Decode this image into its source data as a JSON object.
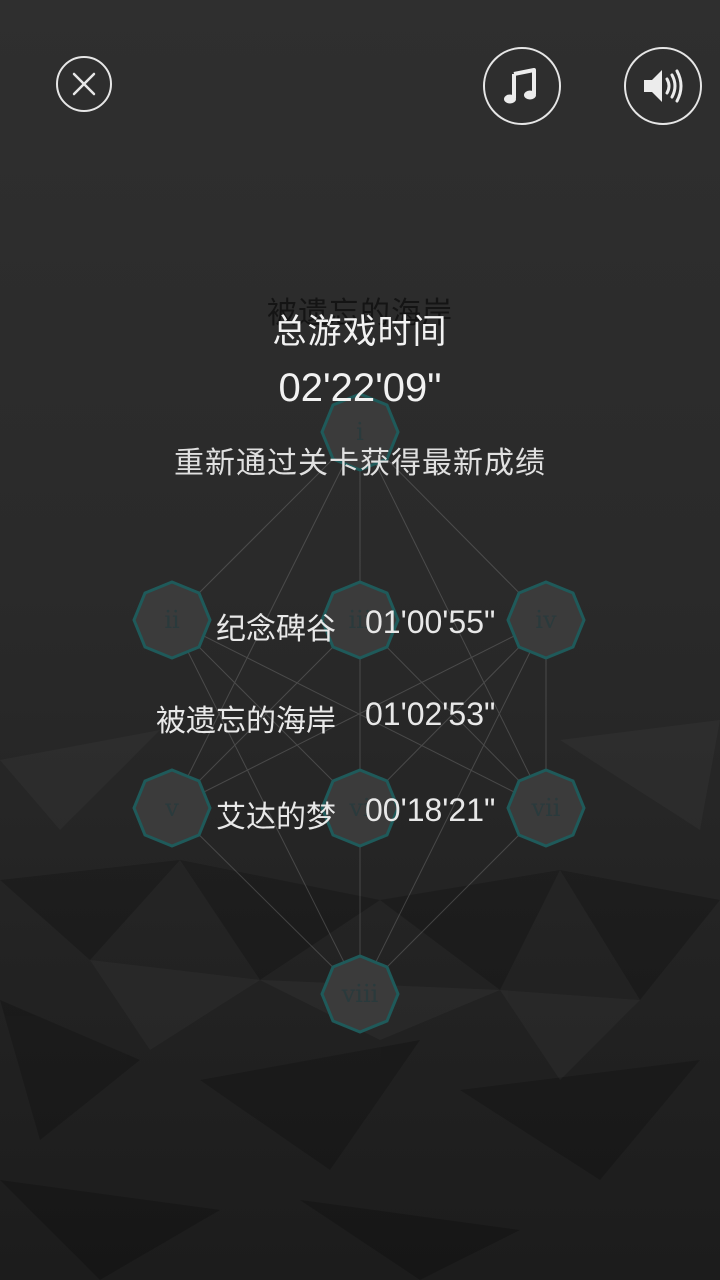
{
  "toolbar": {
    "close_icon": "close-icon",
    "music_icon": "music-note-icon",
    "sound_icon": "speaker-volume-icon"
  },
  "map": {
    "faded_title": "被遗忘的海岸",
    "nodes": [
      "i",
      "ii",
      "iii",
      "iv",
      "v",
      "vi",
      "vii",
      "viii"
    ]
  },
  "summary": {
    "total_label": "总游戏时间",
    "total_time": "02'22'09\"",
    "hint": "重新通过关卡获得最新成绩"
  },
  "records": [
    {
      "name": "纪念碑谷",
      "time": "01'00'55\""
    },
    {
      "name": "被遗忘的海岸",
      "time": "01'02'53\""
    },
    {
      "name": "艾达的梦",
      "time": "00'18'21\""
    }
  ],
  "colors": {
    "background": "#2a2a2a",
    "node_fill": "#3b3b3b",
    "node_border": "#1f5a5a",
    "text": "#f2f2f2"
  }
}
